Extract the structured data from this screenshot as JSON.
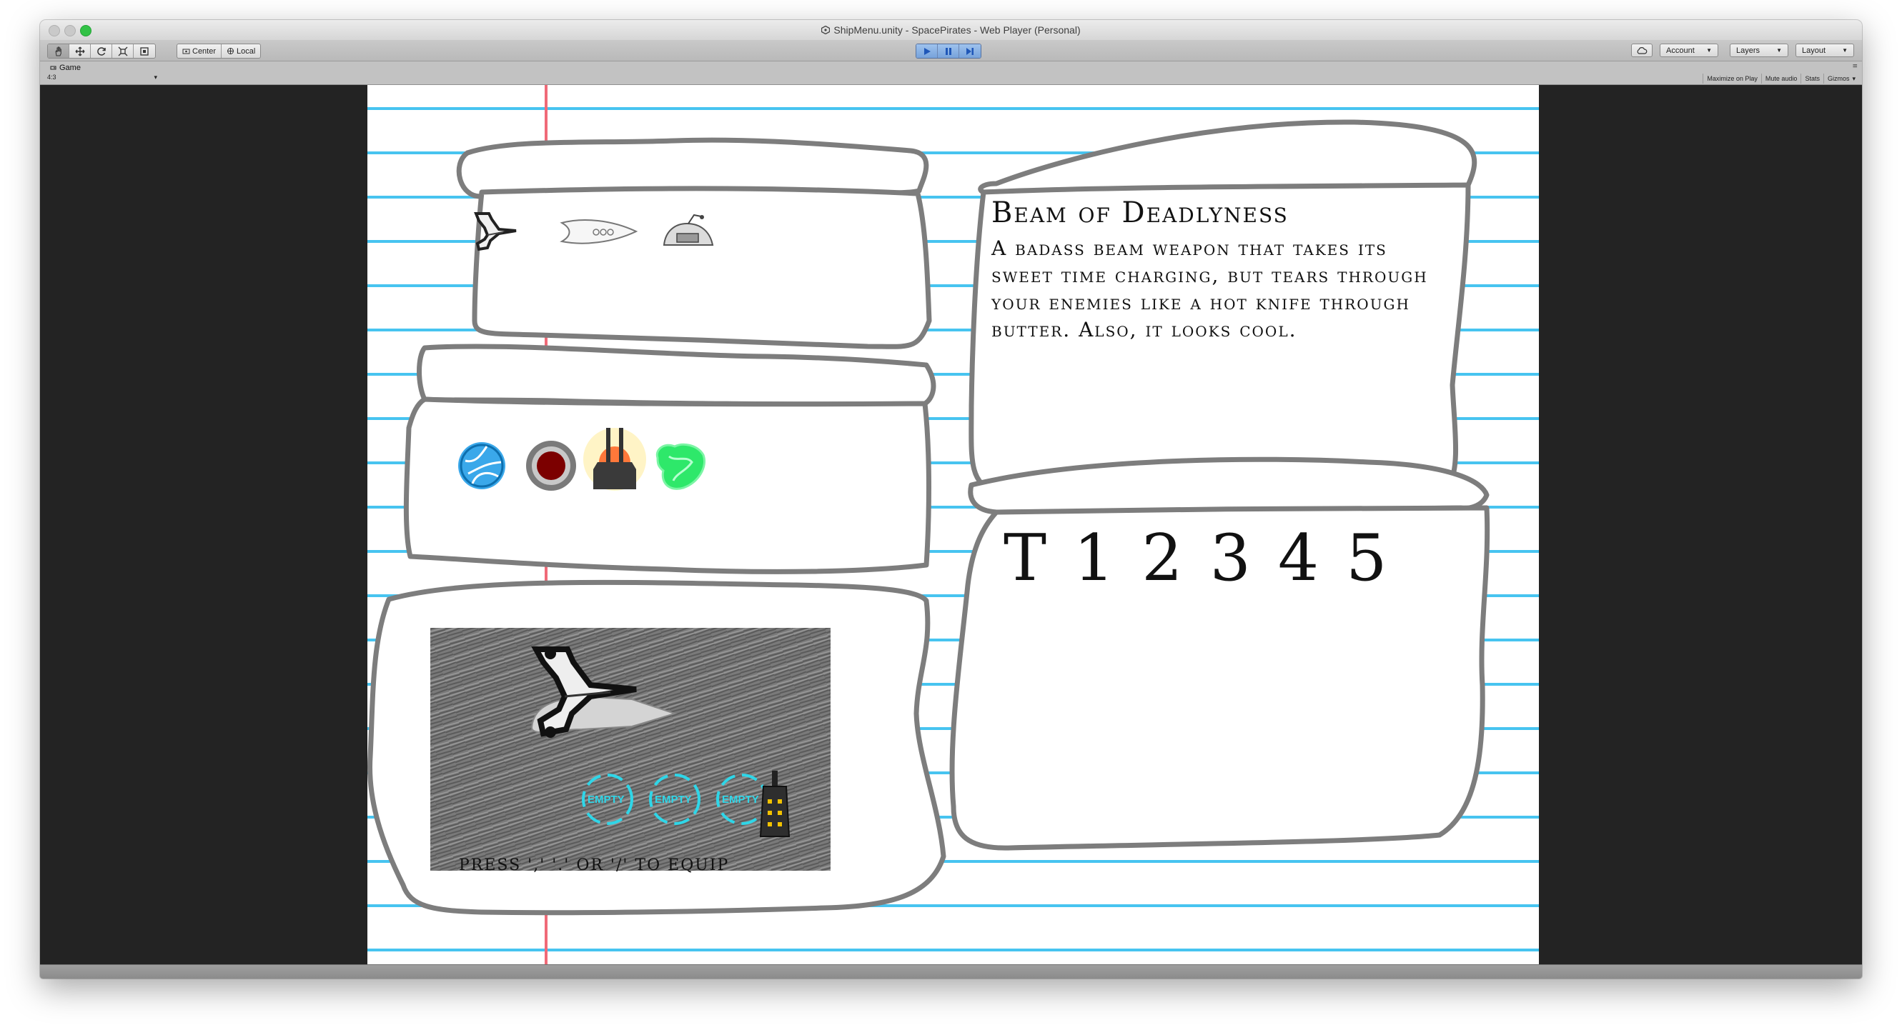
{
  "window": {
    "title": "ShipMenu.unity - SpacePirates - Web Player (Personal)"
  },
  "toolbar": {
    "pivot_label": "Center",
    "space_label": "Local",
    "account_label": "Account",
    "layers_label": "Layers",
    "layout_label": "Layout"
  },
  "game_tab": {
    "label": "Game",
    "aspect": "4:3",
    "options": [
      "Maximize on Play",
      "Mute audio",
      "Stats",
      "Gizmos"
    ]
  },
  "ship_menu": {
    "item_title": "Beam of Deadlyness",
    "item_description": "A badass beam weapon that takes its sweet time charging, but tears through your enemies like a hot knife through butter. Also, it looks cool.",
    "ability_slots": [
      "T",
      "1",
      "2",
      "3",
      "4",
      "5"
    ],
    "equip_slots": [
      "EMPTY",
      "EMPTY",
      "EMPTY"
    ],
    "equip_hint": "PRESS ',' '.' OR '/' TO EQUIP",
    "ships": [
      "ship-claw-icon",
      "ship-fish-icon",
      "ship-pod-icon"
    ],
    "weapons": [
      "shield-orb-icon",
      "red-core-icon",
      "beam-turret-icon",
      "green-crystal-icon"
    ]
  },
  "colors": {
    "notebook_line": "#47c4f0",
    "margin_line": "#f06a78",
    "play_button": "#7aa5dd",
    "slot_cyan": "#2fd6e8"
  }
}
